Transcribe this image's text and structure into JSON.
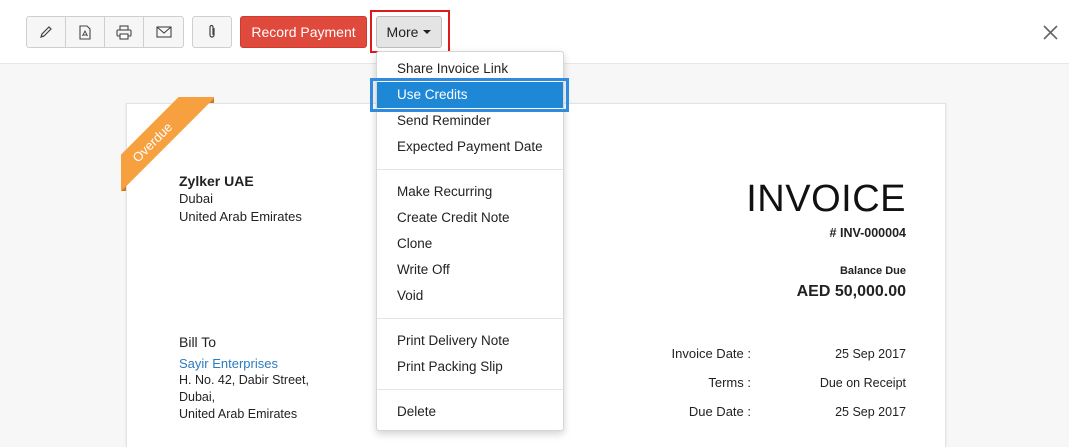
{
  "toolbar": {
    "icons": [
      "pencil-icon",
      "pdf-icon",
      "print-icon",
      "mail-icon",
      "paperclip-icon"
    ],
    "record_payment_label": "Record Payment",
    "more_label": "More",
    "accent_red": "#e04a3d",
    "highlight_blue": "#1e88d6"
  },
  "invoice": {
    "status_ribbon": "Overdue",
    "company": {
      "name": "Zylker UAE",
      "city": "Dubai",
      "country": "United Arab Emirates"
    },
    "title": "INVOICE",
    "number": "# INV-000004",
    "balance_due_label": "Balance Due",
    "balance_due_amount": "AED 50,000.00",
    "bill_to": {
      "label": "Bill To",
      "name": "Sayir Enterprises",
      "address1": "H. No. 42, Dabir Street,",
      "address2": "Dubai,",
      "address3": "United Arab Emirates"
    },
    "meta": [
      {
        "label": "Invoice Date :",
        "value": "25 Sep 2017"
      },
      {
        "label": "Terms :",
        "value": "Due on Receipt"
      },
      {
        "label": "Due Date :",
        "value": "25 Sep 2017"
      }
    ]
  },
  "more_menu": {
    "items": [
      "Share Invoice Link",
      "Use Credits",
      "Send Reminder",
      "Expected Payment Date",
      "Make Recurring",
      "Create Credit Note",
      "Clone",
      "Write Off",
      "Void",
      "Print Delivery Note",
      "Print Packing Slip",
      "Delete"
    ],
    "active_item": "Use Credits"
  }
}
